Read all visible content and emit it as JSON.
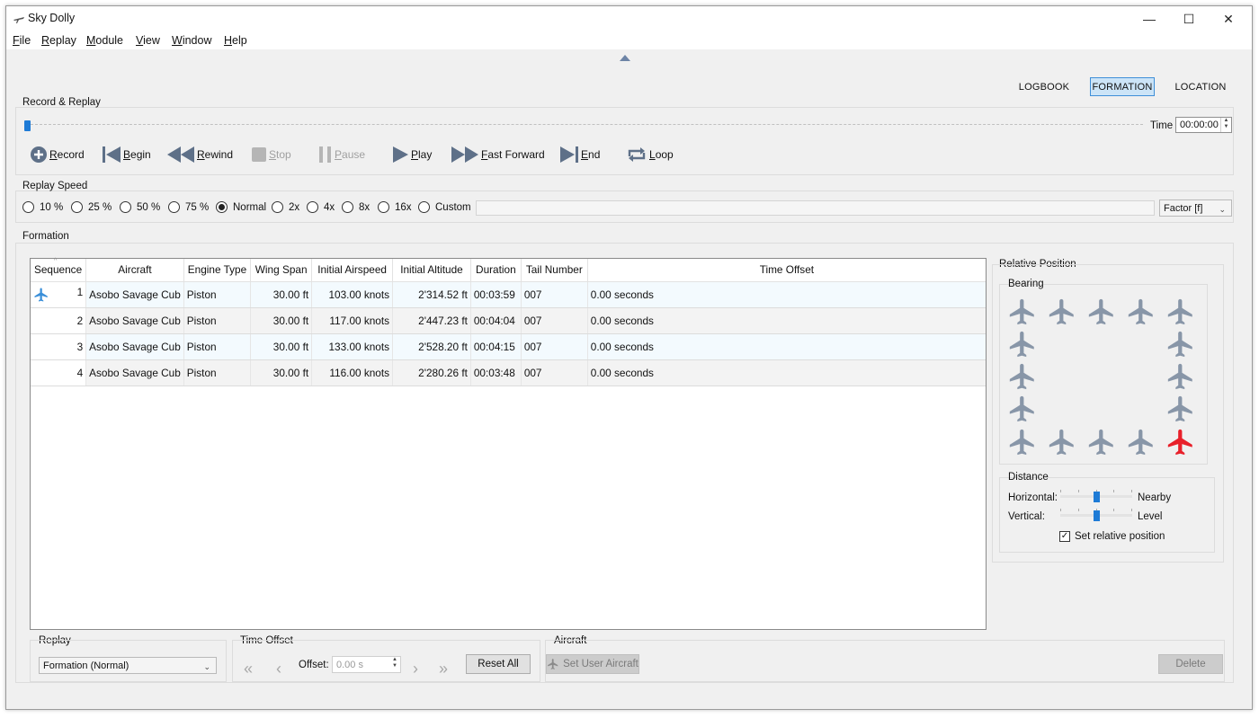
{
  "window": {
    "title": "Sky Dolly",
    "minimize": "—",
    "maximize": "☐",
    "close": "✕"
  },
  "menu": [
    "File",
    "Replay",
    "Module",
    "View",
    "Window",
    "Help"
  ],
  "modules": {
    "logbook": "LOGBOOK",
    "formation": "FORMATION",
    "location": "LOCATION",
    "active": "FORMATION"
  },
  "record_replay": {
    "title": "Record & Replay",
    "time_label": "Time",
    "time_value": "00:00:00",
    "position": 0,
    "buttons": {
      "record": "Record",
      "begin": "Begin",
      "rewind": "Rewind",
      "stop": "Stop",
      "pause": "Pause",
      "play": "Play",
      "fast_forward": "Fast Forward",
      "end": "End",
      "loop": "Loop"
    }
  },
  "replay_speed": {
    "title": "Replay Speed",
    "options": [
      "10 %",
      "25 %",
      "50 %",
      "75 %",
      "Normal",
      "2x",
      "4x",
      "8x",
      "16x",
      "Custom"
    ],
    "selected": "Normal",
    "factor": "Factor [f]"
  },
  "formation": {
    "title": "Formation",
    "columns": [
      "Sequence",
      "Aircraft",
      "Engine Type",
      "Wing Span",
      "Initial Airspeed",
      "Initial Altitude",
      "Duration",
      "Tail Number",
      "Time Offset"
    ],
    "rows": [
      {
        "seq": "1",
        "aircraft": "Asobo Savage Cub",
        "engine": "Piston",
        "span": "30.00 ft",
        "airspeed": "103.00 knots",
        "altitude": "2'314.52 ft",
        "duration": "00:03:59",
        "tail": "007",
        "offset": "0.00 seconds",
        "user": true
      },
      {
        "seq": "2",
        "aircraft": "Asobo Savage Cub",
        "engine": "Piston",
        "span": "30.00 ft",
        "airspeed": "117.00 knots",
        "altitude": "2'447.23 ft",
        "duration": "00:04:04",
        "tail": "007",
        "offset": "0.00 seconds",
        "user": false
      },
      {
        "seq": "3",
        "aircraft": "Asobo Savage Cub",
        "engine": "Piston",
        "span": "30.00 ft",
        "airspeed": "133.00 knots",
        "altitude": "2'528.20 ft",
        "duration": "00:04:15",
        "tail": "007",
        "offset": "0.00 seconds",
        "user": false
      },
      {
        "seq": "4",
        "aircraft": "Asobo Savage Cub",
        "engine": "Piston",
        "span": "30.00 ft",
        "airspeed": "116.00 knots",
        "altitude": "2'280.26 ft",
        "duration": "00:03:48",
        "tail": "007",
        "offset": "0.00 seconds",
        "user": false
      }
    ]
  },
  "relative_position": {
    "title": "Relative Position",
    "bearing_title": "Bearing",
    "selected_bearing": "bottom-right",
    "plane_color": "#8896a8",
    "selected_color": "#e8202a",
    "distance_title": "Distance",
    "horizontal_label": "Horizontal:",
    "horizontal_value": "Nearby",
    "vertical_label": "Vertical:",
    "vertical_value": "Level",
    "horizontal_level": 0.5,
    "vertical_level": 0.5,
    "set_relative_position": "Set relative position",
    "set_relative_checked": true
  },
  "bottom": {
    "replay_title": "Replay",
    "replay_mode": "Formation (Normal)",
    "time_offset_title": "Time Offset",
    "offset_label": "Offset:",
    "offset_value": "0.00 s",
    "reset_all": "Reset All",
    "aircraft_title": "Aircraft",
    "set_user_aircraft": "Set User Aircraft",
    "delete": "Delete"
  },
  "colors": {
    "accent": "#1e7bd6",
    "active_tab_bg": "#cce4f7",
    "active_tab_border": "#3f8fd8"
  }
}
